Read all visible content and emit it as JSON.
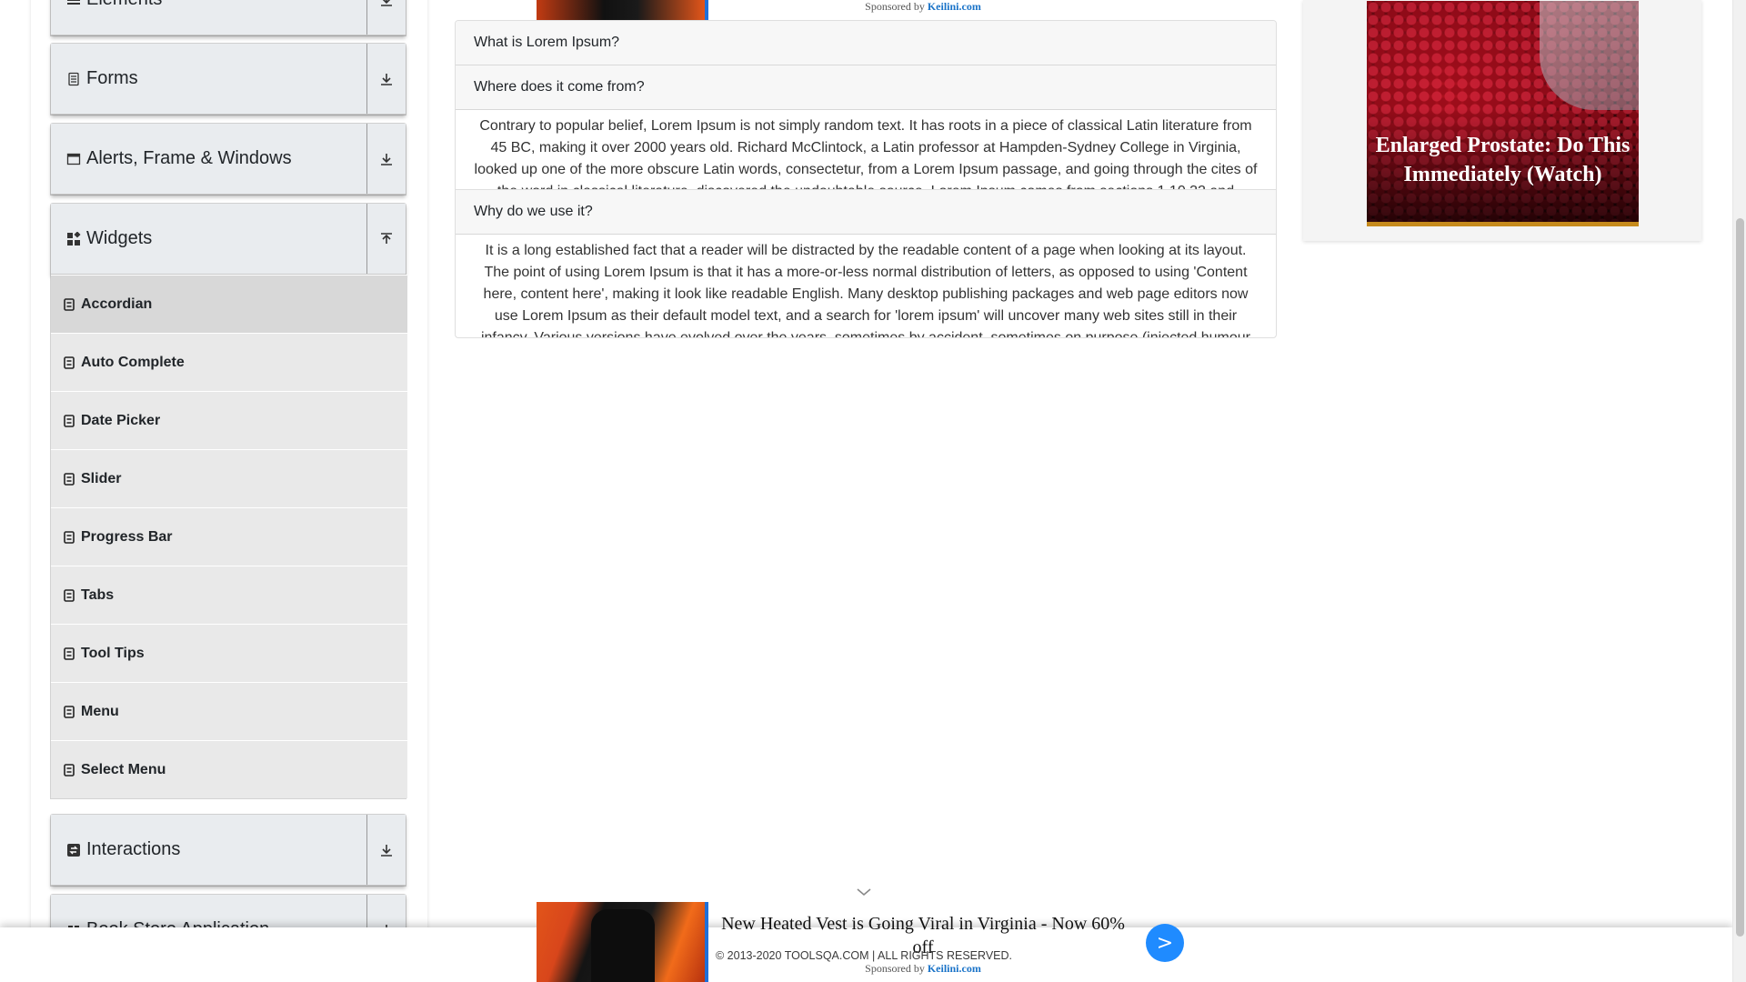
{
  "sidebar": {
    "groups": [
      {
        "label": "Elements",
        "icon": "elements-icon",
        "toggle_icon": "download-arrow-icon"
      },
      {
        "label": "Forms",
        "icon": "form-icon",
        "toggle_icon": "download-arrow-icon"
      },
      {
        "label": "Alerts, Frame & Windows",
        "icon": "window-icon",
        "toggle_icon": "download-arrow-icon"
      },
      {
        "label": "Widgets",
        "icon": "widgets-icon",
        "toggle_icon": "upload-arrow-icon"
      },
      {
        "label": "Interactions",
        "icon": "interactions-icon",
        "toggle_icon": "download-arrow-icon"
      },
      {
        "label": "Book Store Application",
        "icon": "book-icon",
        "toggle_icon": "download-arrow-icon"
      }
    ],
    "widget_items": [
      {
        "label": "Accordian",
        "active": true
      },
      {
        "label": "Auto Complete"
      },
      {
        "label": "Date Picker"
      },
      {
        "label": "Slider"
      },
      {
        "label": "Progress Bar"
      },
      {
        "label": "Tabs"
      },
      {
        "label": "Tool Tips"
      },
      {
        "label": "Menu"
      },
      {
        "label": "Select Menu"
      }
    ]
  },
  "accordion": {
    "sections": [
      {
        "title": "What is Lorem Ipsum?"
      },
      {
        "title": "Where does it come from?",
        "body": "Contrary to popular belief, Lorem Ipsum is not simply random text. It has roots in a piece of classical Latin literature from 45 BC, making it over 2000 years old. Richard McClintock, a Latin professor at Hampden-Sydney College in Virginia, looked up one of the more obscure Latin words, consectetur, from a Lorem Ipsum passage, and going through the cites of the word in classical literature, discovered the undoubtable source. Lorem Ipsum comes from sections 1.10.32 and"
      },
      {
        "title": "Why do we use it?",
        "body": "It is a long established fact that a reader will be distracted by the readable content of a page when looking at its layout. The point of using Lorem Ipsum is that it has a more-or-less normal distribution of letters, as opposed to using 'Content here, content here', making it look like readable English. Many desktop publishing packages and web page editors now use Lorem Ipsum as their default model text, and a search for 'lorem ipsum' will uncover many web sites still in their infancy. Various versions have evolved over the years, sometimes by accident, sometimes on purpose (injected humour"
      }
    ]
  },
  "ads": {
    "top_sponsor_prefix": "Sponsored by ",
    "top_sponsor_name": "Keilini.com",
    "right_title": "Enlarged Prostate: Do This Immediately (Watch)",
    "bottom_headline": "New Heated Vest is Going Viral in Virginia - Now 60% off",
    "bottom_button": ">",
    "bottom_sponsor_prefix": "Sponsored by ",
    "bottom_sponsor_name": "Keilini.com"
  },
  "footer": {
    "text": "© 2013-2020 TOOLSQA.COM | ALL RIGHTS RESERVED."
  },
  "colors": {
    "sidebar_bg": "#e9ecef",
    "active_item": "#d8d8d8",
    "ad_button": "#1f8bff",
    "sponsor_link": "#1a73c8"
  }
}
